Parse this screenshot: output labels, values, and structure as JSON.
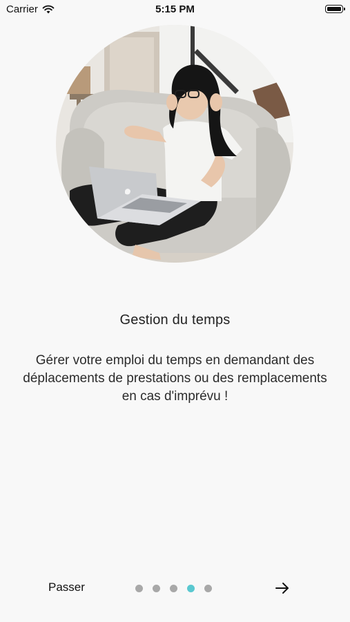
{
  "status_bar": {
    "carrier": "Carrier",
    "time": "5:15 PM",
    "icons": [
      "wifi-icon",
      "battery-icon"
    ]
  },
  "hero": {
    "icon": "woman-with-laptop-illustration"
  },
  "slide": {
    "title": "Gestion du temps",
    "description": "Gérer votre emploi du temps en demandant des déplacements de prestations ou des remplacements en cas d'imprévu !"
  },
  "footer": {
    "skip_label": "Passer",
    "page_indicator": {
      "total": 5,
      "current": 4
    },
    "next_icon": "arrow-right-icon",
    "colors": {
      "active_dot": "#5ac8d0",
      "inactive_dot": "#a8a8a8"
    }
  }
}
